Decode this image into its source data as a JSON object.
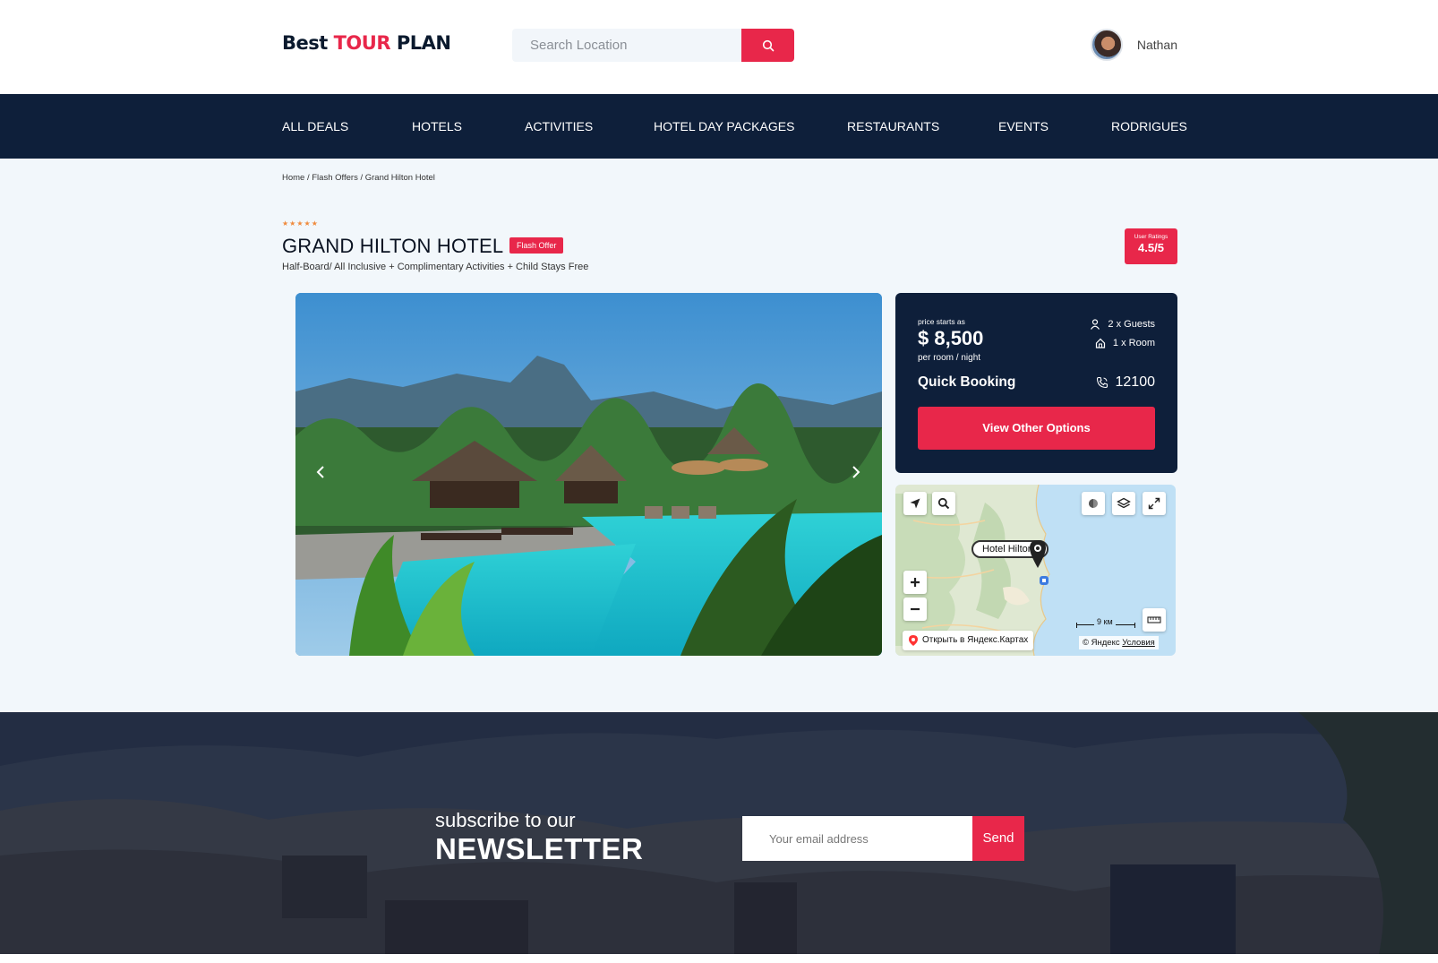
{
  "header": {
    "logo": {
      "part1": "Best ",
      "part2": "TOUR",
      "part3": " PLAN"
    },
    "search": {
      "placeholder": "Search Location",
      "value": ""
    },
    "user": {
      "name": "Nathan"
    }
  },
  "nav": {
    "items": [
      "ALL DEALS",
      "HOTELS",
      "ACTIVITIES",
      "HOTEL DAY PACKAGES",
      "RESTAURANTS",
      "EVENTS",
      "RODRIGUES"
    ]
  },
  "breadcrumb": "Home / Flash Offers / Grand Hilton Hotel",
  "hotel": {
    "stars": "★★★★★",
    "star_count": 5,
    "title": "GRAND HILTON HOTEL",
    "badge": "Flash Offer",
    "subtitle": "Half-Board/ All Inclusive + Complimentary Activities + Child Stays Free",
    "rating_label": "User Ratings",
    "rating_value": "4.5/5"
  },
  "booking": {
    "price_label": "price starts as",
    "price": "$ 8,500",
    "per_room": "per room / night",
    "guests": "2 x Guests",
    "rooms": "1 x Room",
    "quick_title": "Quick Booking",
    "phone": "12100",
    "button": "View Other Options"
  },
  "map": {
    "pin_label": "Hotel Hilton",
    "open_link": "Открыть в Яндекс.Картах",
    "scale": "9 км",
    "copyright": "© Яндекс",
    "terms": "Условия"
  },
  "newsletter": {
    "subtitle": "subscribe to our",
    "title": "NEWSLETTER",
    "placeholder": "Your email address",
    "send": "Send"
  },
  "colors": {
    "accent": "#e8274a",
    "navy": "#0e1f3a",
    "star": "#f08a3c"
  }
}
